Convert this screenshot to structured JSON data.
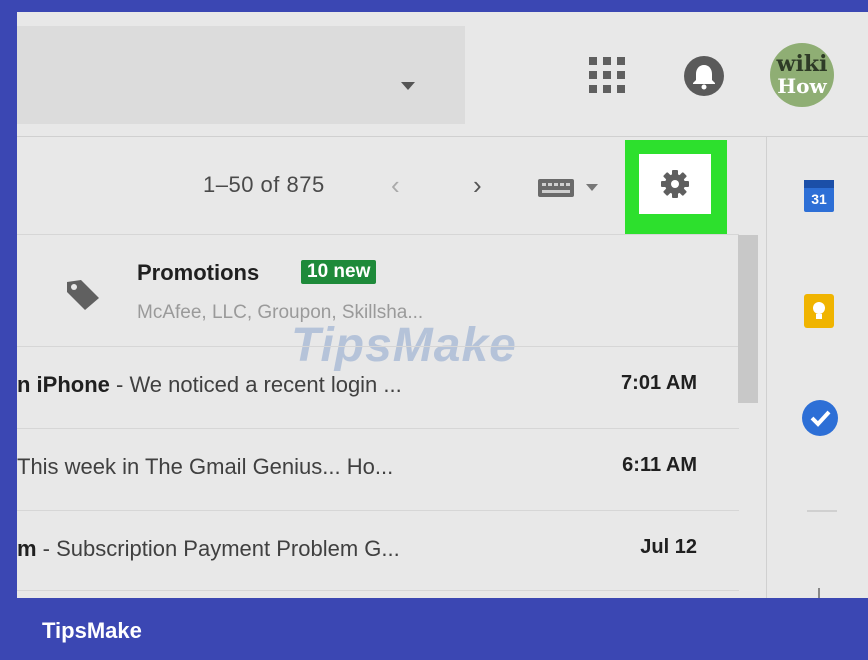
{
  "header": {
    "apps_icon": "apps-grid-icon",
    "notifications_icon": "bell-icon",
    "avatar": {
      "line1": "wiki",
      "line2": "How"
    }
  },
  "toolbar": {
    "pagination": "1–50 of 875",
    "prev_label": "‹",
    "next_label": "›",
    "input_tools_icon": "keyboard-icon",
    "settings_icon": "gear-icon",
    "highlight_color": "#2de02d"
  },
  "promotions": {
    "title": "Promotions",
    "badge": "10 new",
    "senders": "McAfee, LLC, Groupon, Skillsha..."
  },
  "watermark": "TipsMake",
  "emails": [
    {
      "sender": "n iPhone",
      "snippet": " - We noticed a recent login ...",
      "time": "7:01 AM"
    },
    {
      "sender": "",
      "snippet": "This week in The Gmail Genius... Ho...",
      "time": "6:11 AM"
    },
    {
      "sender": "m",
      "snippet": " - Subscription Payment Problem G...",
      "time": "Jul 12"
    }
  ],
  "side_panel": {
    "calendar_label": "31",
    "icons": [
      "calendar-icon",
      "keep-icon",
      "tasks-icon"
    ]
  },
  "footer": {
    "brand": "TipsMake",
    "bar_color": "#3b47b3"
  }
}
